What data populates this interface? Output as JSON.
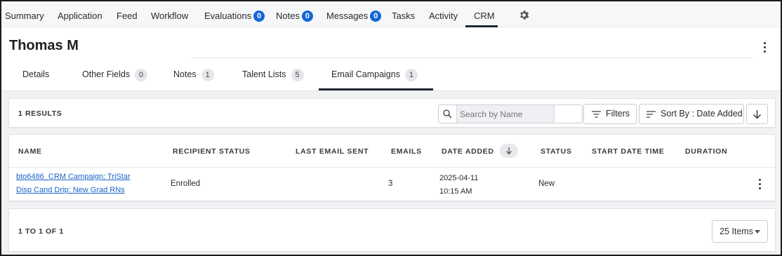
{
  "topnav": {
    "items": [
      {
        "label": "Summary"
      },
      {
        "label": "Application"
      },
      {
        "label": "Feed"
      },
      {
        "label": "Workflow"
      },
      {
        "label": "Evaluations",
        "badge": "0"
      },
      {
        "label": "Notes",
        "badge": "0"
      },
      {
        "label": "Messages",
        "badge": "0"
      },
      {
        "label": "Tasks"
      },
      {
        "label": "Activity"
      },
      {
        "label": "CRM"
      }
    ],
    "active": "CRM",
    "settings_icon": "gear-icon",
    "badge_color": "#1565d8"
  },
  "header": {
    "title": "Thomas M",
    "menu_icon": "kebab-vertical-icon"
  },
  "subtabs": {
    "items": [
      {
        "label": "Details"
      },
      {
        "label": "Other Fields",
        "count": "0"
      },
      {
        "label": "Notes",
        "count": "1"
      },
      {
        "label": "Talent Lists",
        "count": "5"
      },
      {
        "label": "Email Campaigns",
        "count": "1"
      }
    ],
    "active": "Email Campaigns"
  },
  "toolbar": {
    "results_label": "1 RESULTS",
    "search_placeholder": "Search by Name",
    "search_value": "",
    "filters_label": "Filters",
    "sort_label": "Sort By : Date Added",
    "sort_direction_icon": "arrow-down-icon"
  },
  "table": {
    "columns": [
      "NAME",
      "RECIPIENT STATUS",
      "LAST EMAIL SENT",
      "EMAILS",
      "DATE ADDED",
      "STATUS",
      "START DATE TIME",
      "DURATION"
    ],
    "sorted_column": "DATE ADDED",
    "rows": [
      {
        "name_line1": "bto6486_CRM Campaign: TriStar",
        "name_line2": "Disp Cand Drip: New Grad RNs",
        "recipient_status": "Enrolled",
        "last_email_sent": "",
        "emails": "3",
        "date_added_date": "2025-04-11",
        "date_added_time": "10:15 AM",
        "status": "New",
        "start_date_time": "",
        "duration": ""
      }
    ]
  },
  "pager": {
    "range_label": "1 TO 1 OF 1",
    "page_size_label": "25 Items"
  },
  "colors": {
    "accent": "#1565d8",
    "link": "#1a64c8",
    "active_underline": "#1f2733",
    "background_gray": "#f1f2f4"
  }
}
